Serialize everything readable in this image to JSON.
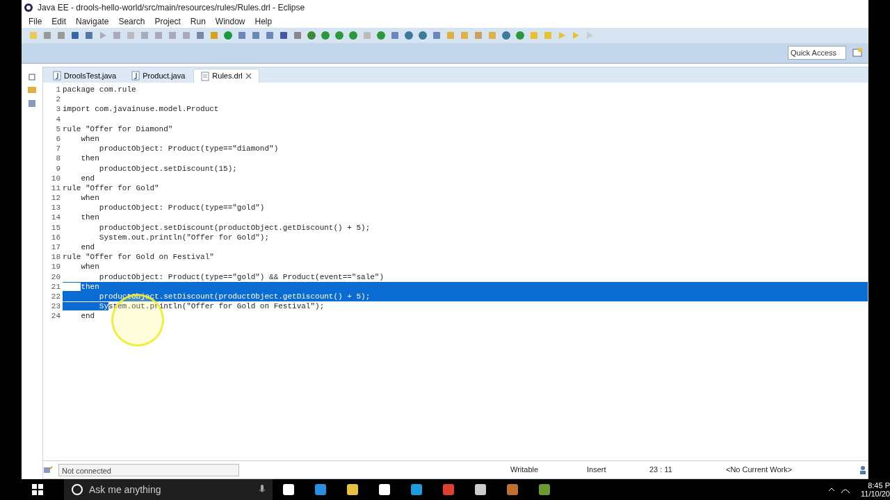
{
  "window": {
    "title": "Java EE - drools-hello-world/src/main/resources/rules/Rules.drl - Eclipse"
  },
  "menu": [
    "File",
    "Edit",
    "Navigate",
    "Search",
    "Project",
    "Run",
    "Window",
    "Help"
  ],
  "quick_access": {
    "placeholder": "Quick Access"
  },
  "tabs": [
    {
      "label": "DroolsTest.java",
      "kind": "java",
      "selected": false
    },
    {
      "label": "Product.java",
      "kind": "java",
      "selected": false
    },
    {
      "label": "Rules.drl",
      "kind": "file",
      "selected": true
    }
  ],
  "code": [
    {
      "number": "1",
      "text": "package com.rule",
      "selected": false
    },
    {
      "number": "2",
      "selected": false
    },
    {
      "number": "3",
      "text": "import com.javainuse.model.Product",
      "selected": false
    },
    {
      "number": "4",
      "selected": false
    },
    {
      "number": "5",
      "text": "rule \"Offer for Diamond\"",
      "selected": false
    },
    {
      "number": "6",
      "text": "    when",
      "selected": false
    },
    {
      "number": "7",
      "text": "        productObject: Product(type==\"diamond\")",
      "selected": false
    },
    {
      "number": "8",
      "text": "    then",
      "selected": false
    },
    {
      "number": "9",
      "text": "        productObject.setDiscount(15);",
      "selected": false
    },
    {
      "number": "10",
      "text": "    end",
      "selected": false
    },
    {
      "number": "11",
      "text": "rule \"Offer for Gold\"",
      "selected": false
    },
    {
      "number": "12",
      "text": "    when",
      "selected": false
    },
    {
      "number": "13",
      "text": "        productObject: Product(type==\"gold\")",
      "selected": false
    },
    {
      "number": "14",
      "text": "    then",
      "selected": false
    },
    {
      "number": "15",
      "text": "        productObject.setDiscount(productObject.getDiscount() + 5);",
      "selected": false
    },
    {
      "number": "16",
      "text": "        System.out.println(\"Offer for Gold\");",
      "selected": false
    },
    {
      "number": "17",
      "text": "    end",
      "selected": false
    },
    {
      "number": "18",
      "text": "rule \"Offer for Gold on Festival\"",
      "selected": false
    },
    {
      "number": "19",
      "text": "    when",
      "selected": false
    },
    {
      "number": "20",
      "text": "        productObject: Product(type==\"gold\") && Product(event==\"sale\")",
      "selected": false
    },
    {
      "number": "21",
      "text": "    then",
      "selected": true,
      "selection_from_text": true
    },
    {
      "number": "22",
      "text": "        productObject.setDiscount(productObject.getDiscount() + 5);",
      "selected": true,
      "selection_from_text": false
    },
    {
      "number": "23",
      "segments": [
        {
          "text": "        Sy",
          "selected": true
        },
        {
          "text": "stem.out.println(\"Offer for Gold on Festival\");",
          "selected": false
        }
      ],
      "selected": false
    },
    {
      "number": "24",
      "text": "    end",
      "selected": false
    }
  ],
  "status_bar": {
    "connection": "Not connected",
    "mode": "Writable",
    "insert": "Insert",
    "position": "23 : 11",
    "work": "<No Current Work>"
  },
  "taskbar": {
    "search": {
      "placeholder": "Ask me anything"
    },
    "time": "8:45 P",
    "date": "11/10/20"
  }
}
